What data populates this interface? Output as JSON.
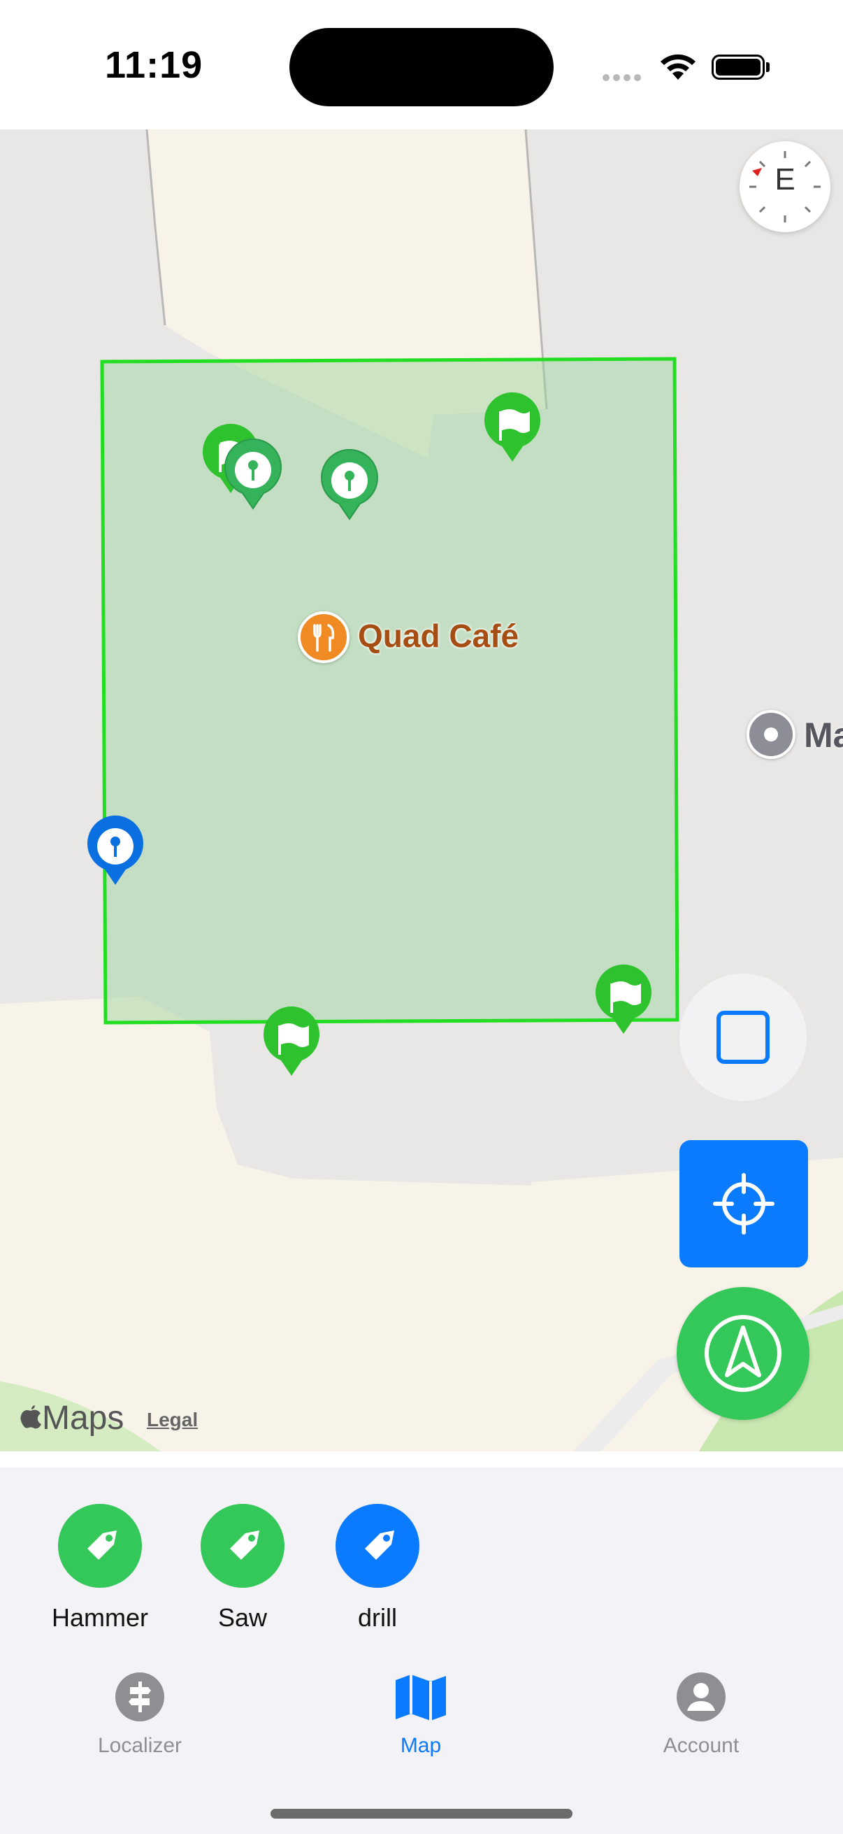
{
  "status": {
    "time": "11:19"
  },
  "map": {
    "compass_letter": "E",
    "poi_main": {
      "label": "Quad Café",
      "icon": "fork-knife-icon"
    },
    "poi_secondary": {
      "label": "Ma",
      "icon": "dot-icon"
    },
    "branding": {
      "apple_logo": "apple-logo-icon",
      "maps_label": "Maps",
      "legal_label": "Legal"
    },
    "region_color": "#22dd22",
    "pin_colors": {
      "flag": "#2fc22f",
      "marker": "#34b35a",
      "marker_selected": "#0a6fe0"
    }
  },
  "controls": {
    "square_icon": "square-icon",
    "locate_icon": "crosshair-icon",
    "navigate_icon": "compass-arrow-icon"
  },
  "tags": [
    {
      "label": "Hammer",
      "color": "#34c759",
      "icon": "tag-icon"
    },
    {
      "label": "Saw",
      "color": "#34c759",
      "icon": "tag-icon"
    },
    {
      "label": "drill",
      "color": "#0a7aff",
      "icon": "tag-icon"
    }
  ],
  "tabbar": {
    "items": [
      {
        "label": "Localizer",
        "icon": "signpost-icon",
        "active": false
      },
      {
        "label": "Map",
        "icon": "map-icon",
        "active": true
      },
      {
        "label": "Account",
        "icon": "person-circle-icon",
        "active": false
      }
    ],
    "active_color": "#0a7aff",
    "inactive_color": "#8e8e93"
  }
}
